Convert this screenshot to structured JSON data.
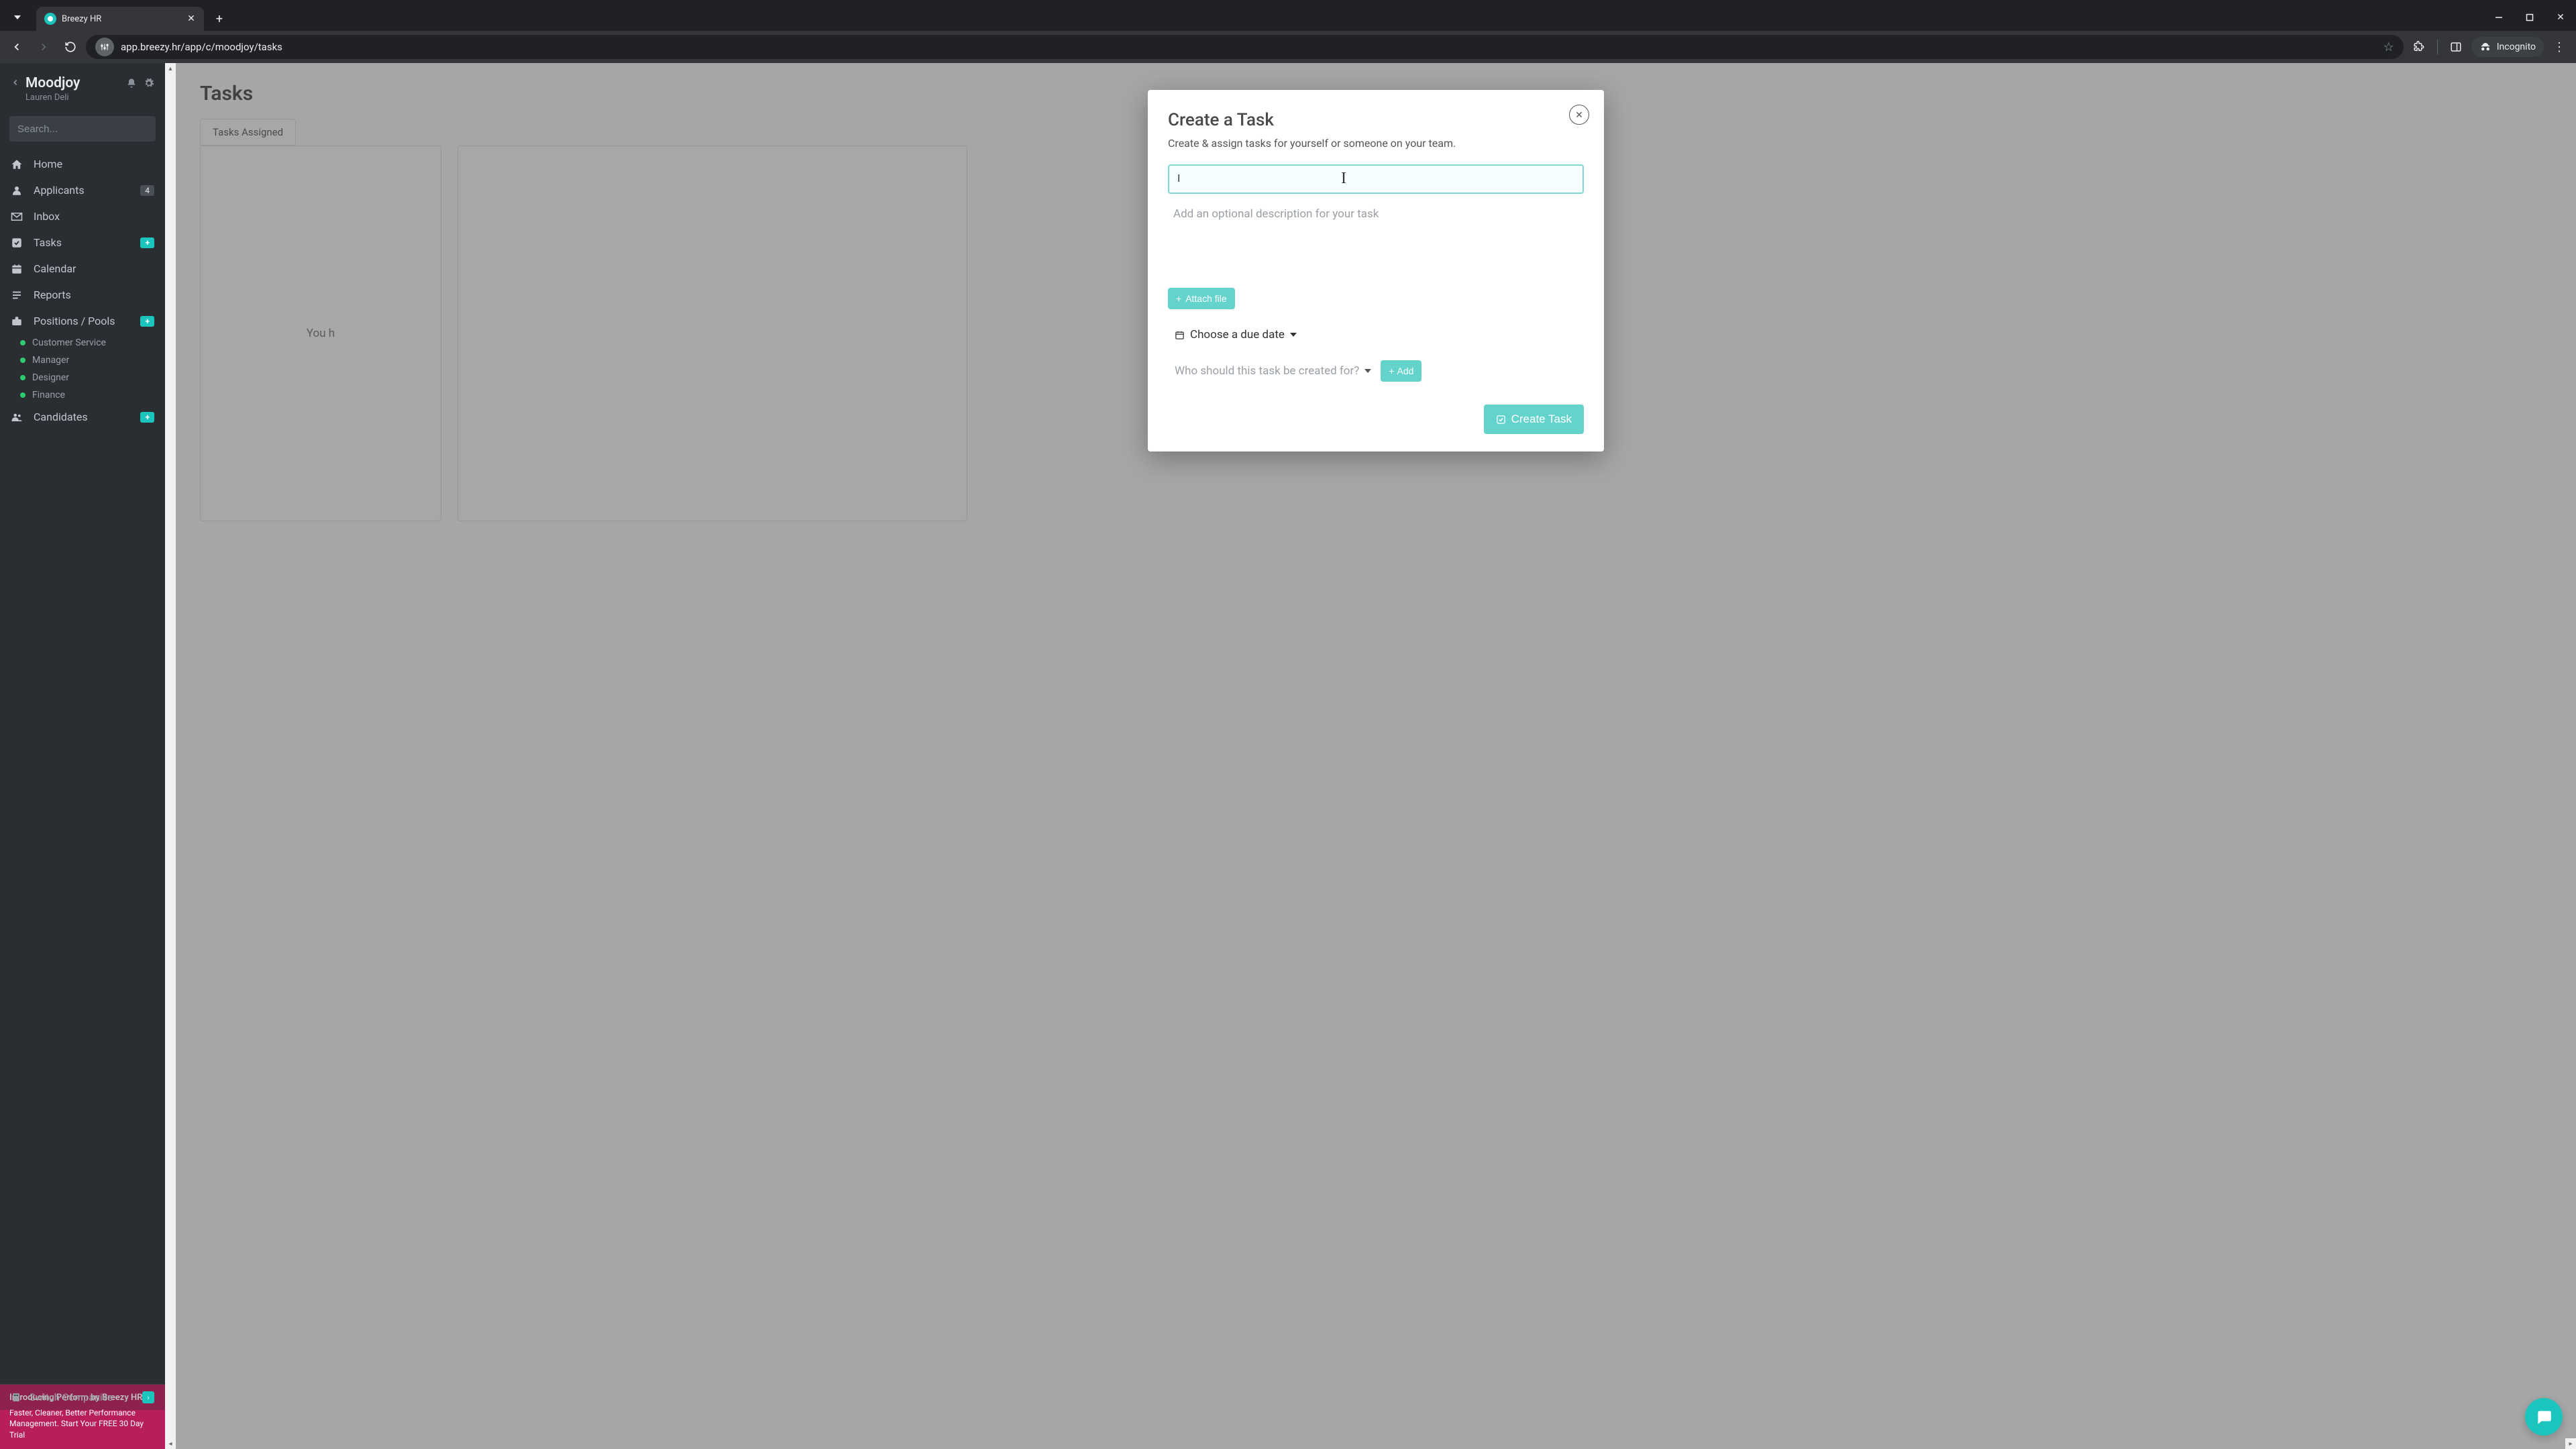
{
  "browser": {
    "tab_title": "Breezy HR",
    "url": "app.breezy.hr/app/c/moodjoy/tasks",
    "incognito_label": "Incognito"
  },
  "sidebar": {
    "company": "Moodjoy",
    "user": "Lauren Deli",
    "search_placeholder": "Search...",
    "items": [
      {
        "icon": "home",
        "label": "Home"
      },
      {
        "icon": "user",
        "label": "Applicants",
        "badge": "4"
      },
      {
        "icon": "envelope",
        "label": "Inbox"
      },
      {
        "icon": "check",
        "label": "Tasks",
        "badge": "+",
        "badge_kind": "plus"
      },
      {
        "icon": "calendar",
        "label": "Calendar"
      },
      {
        "icon": "list",
        "label": "Reports"
      },
      {
        "icon": "briefcase",
        "label": "Positions / Pools",
        "badge": "+",
        "badge_kind": "plus"
      }
    ],
    "positions": [
      "Customer Service",
      "Manager",
      "Designer",
      "Finance"
    ],
    "candidates_label": "Candidates",
    "switch_label": "Switch Companies",
    "promo_title": "Introducing Perform by Breezy HR",
    "promo_body": "Faster, Cleaner, Better Performance Management. Start Your FREE 30 Day Trial"
  },
  "main": {
    "title": "Tasks",
    "tab_label": "Tasks Assigned",
    "empty_message": "You have no tasks"
  },
  "modal": {
    "title": "Create a Task",
    "subtitle": "Create & assign tasks for yourself or someone on your team.",
    "title_value": "I",
    "desc_placeholder": "Add an optional description for your task",
    "attach_label": "Attach file",
    "due_label": "Choose a due date",
    "assignee_label": "Who should this task be created for?",
    "add_label": "Add",
    "create_label": "Create Task"
  }
}
